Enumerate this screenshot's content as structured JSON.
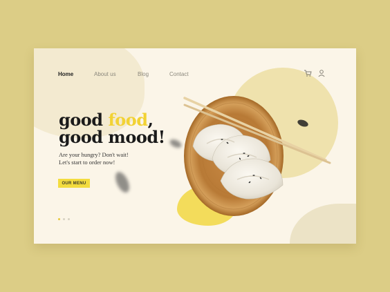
{
  "nav": {
    "items": [
      {
        "label": "Home",
        "active": true
      },
      {
        "label": "About us",
        "active": false
      },
      {
        "label": "Blog",
        "active": false
      },
      {
        "label": "Contact",
        "active": false
      }
    ],
    "icons": [
      "cart-icon",
      "user-icon"
    ]
  },
  "hero": {
    "headline_part1": "good ",
    "headline_accent": "food",
    "headline_part2": ",",
    "headline_line2": "good mood!",
    "sub_line1": "Are your hungry? Don't wait!",
    "sub_line2": "Let's start to order now!",
    "button_label": "OUR MENU"
  },
  "carousel": {
    "count": 3,
    "active_index": 0
  },
  "colors": {
    "background": "#dccd86",
    "card": "#fbf5e8",
    "accent": "#f2d234",
    "button": "#f3dc3f"
  }
}
